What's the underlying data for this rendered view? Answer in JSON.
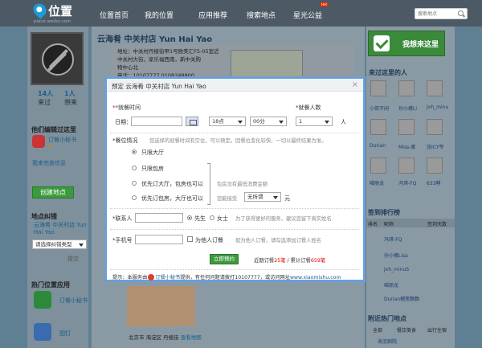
{
  "header": {
    "logo_text": "位置",
    "logo_sub": "place.weibo.com",
    "nav": [
      "位置首页",
      "我的位置",
      "应用推荐",
      "搜索地点",
      "星光公益"
    ],
    "hot_badge": "Hot",
    "search_placeholder": "搜索地点"
  },
  "left": {
    "stats": [
      {
        "value": "14人",
        "label": "来过"
      },
      {
        "value": "1人",
        "label": "想来"
      }
    ],
    "editors_title": "他们编辑过这里",
    "editor_name": "订餐小秘书",
    "editor_sub": "Ⅴ",
    "improve_link": "我来完善信息",
    "create_button": "创建地点",
    "correction_title": "地点纠错",
    "correction_shop": "云海肴 中关村店 Yun Hai Yao",
    "correction_select": "请选择纠错类型",
    "correction_submit": "提交",
    "apps_title": "热门位置应用",
    "apps": [
      {
        "name": "订餐小秘书"
      },
      {
        "name": "图钉"
      }
    ]
  },
  "main": {
    "shop_title": "云海肴 中关村店 Yun Hai Yao",
    "address_lines": [
      "地址：中关村丹棱街甲1号欧美汇F5-05室近",
      "中关村大街，家乐福西南，新中关购",
      "物中心北",
      "电话：10107777 0108348800"
    ],
    "bottom_location": "北京市 海淀区 丹棱街",
    "bottom_map_link": "查看地图"
  },
  "right": {
    "i_am_here": "我想来这里",
    "visitors_title": "来过这里的人",
    "visitors": [
      "小荷不闲",
      "孙小檬Li",
      "Jxh_minu",
      "Durian",
      "Miss-蛋",
      "张ICY爷",
      "喵丽龙",
      "冯琪-FQ",
      "633啊"
    ],
    "rank_title": "签到排行榜",
    "rank_headers": [
      "排名",
      "昵称",
      "签到天数"
    ],
    "rank_rows": [
      "冯琪-FQ",
      "孙小檬Lisa",
      "Jxh_minuS",
      "喵丽龙",
      "Durian榴莲飘飘"
    ],
    "nearby_title": "附近热门地点",
    "nearby_tabs": [
      "全部",
      "餐饮美食",
      "出行住宿"
    ],
    "nearby_first": "海淀剧院"
  },
  "modal": {
    "title": "预定 云海肴 中关村店 Yun Hai Yao",
    "close": "×",
    "time_label": "*就餐时间",
    "people_label": "*就餐人数",
    "date_label": "日期：",
    "hour": "18点",
    "minute": "00分",
    "people": "1",
    "people_unit": "人",
    "seat_label": "*餐位情况",
    "seat_hint": "您选择的就餐时间有空位，可以预定。因餐位变化较快，一切以最终结果为准。",
    "opt1": "只限大厅",
    "opt2": "只限包房",
    "opt3": "优先订大厅，包房也可以",
    "opt4": "优先订包房，大厅也可以",
    "room_note": "包房没有最低消费金额",
    "room_accept": "您能接受",
    "room_select": "无所谓",
    "room_unit": "元",
    "contact_label": "*联系人",
    "gender_m": "先生",
    "gender_f": "女士",
    "contact_hint": "为了获得更好的服务，建议您留下真实姓名",
    "phone_label": "*手机号",
    "other_check": "为他人订餐",
    "other_hint": "如为他人订餐，请勾选添加订餐人姓名",
    "submit": "立即预约",
    "recent_prefix": "近期订餐",
    "recent_count": "25笔",
    "total_prefix": "/ 累计订餐",
    "total_count": "659笔",
    "footer_a": "提示：本服务由",
    "footer_brand": "订餐小秘书",
    "footer_b": "提供，有任何问题请拨打10107777，或访问网址",
    "footer_url": "www.xiaomishu.com"
  },
  "colors": {
    "accent": "#3c9a3c",
    "modal_border": "#6b9fd8",
    "link": "#1d5d8a",
    "topbar": "#4d5a65"
  }
}
